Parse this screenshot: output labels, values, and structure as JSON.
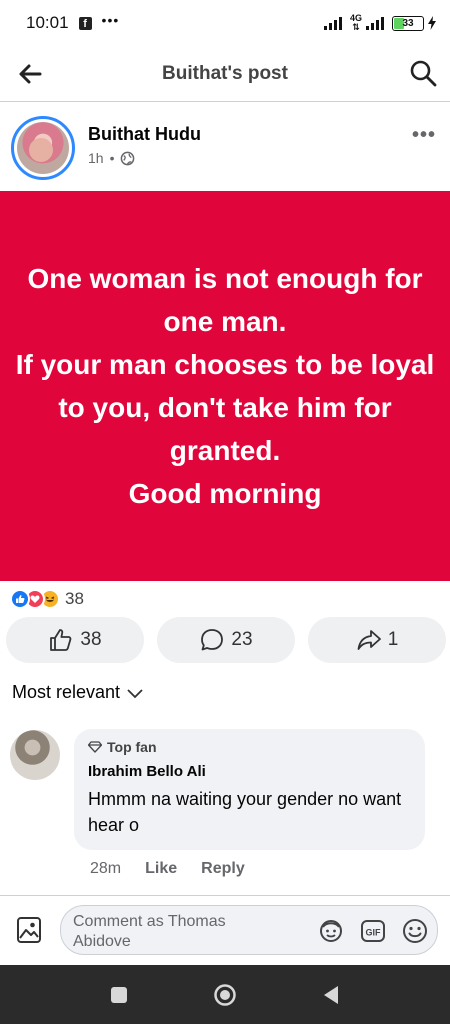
{
  "status_bar": {
    "time": "10:01",
    "network_label": "4G",
    "battery_level": "33",
    "battery_fraction": 0.33
  },
  "header": {
    "title": "Buithat's post"
  },
  "post": {
    "author": "Buithat Hudu",
    "time": "1h",
    "privacy_icon": "globe-icon",
    "background_color": "#e0053b",
    "text": "One woman is not enough for one man.\nIf your man chooses to be loyal to you, don't take him for granted.\nGood morning",
    "reaction_total": "38",
    "reaction_types": [
      "like-icon",
      "love-icon",
      "haha-icon"
    ]
  },
  "actions": {
    "like_count": "38",
    "comment_count": "23",
    "share_count": "1"
  },
  "comments_section": {
    "sort_label": "Most relevant",
    "comments": [
      {
        "badge": "Top fan",
        "name": "Ibrahim Bello Ali",
        "text": "Hmmm na waiting your gender no want hear o",
        "time": "28m",
        "like_label": "Like",
        "reply_label": "Reply"
      }
    ]
  },
  "composer": {
    "placeholder": "Comment as Thomas Abidove"
  },
  "colors": {
    "accent": "#1877f2",
    "post_background": "#e0053b",
    "nav_bar": "#2b2b2b"
  }
}
